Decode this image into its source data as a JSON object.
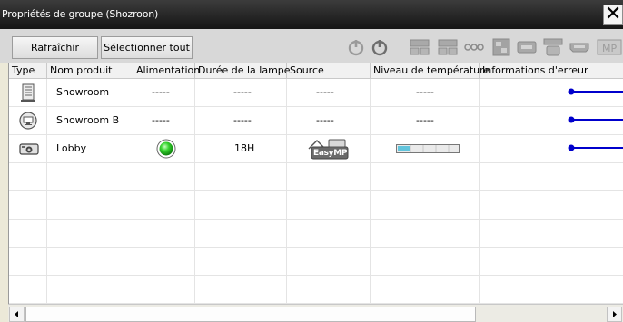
{
  "window": {
    "title": "Propriétés de groupe (Shozroon)",
    "close_glyph": "✕"
  },
  "toolbar": {
    "refresh_label": "Rafraîchir",
    "select_all_label": "Sélectionner tout",
    "icons": [
      "power-on-icon",
      "power-off-icon",
      "source-computer-1-icon",
      "source-computer-2-icon",
      "source-video-icon",
      "source-svideo-icon",
      "source-component-icon",
      "source-dvi-icon",
      "source-hdmi-icon",
      "source-easymp-icon"
    ],
    "icon_labels": {
      "mp": "MP"
    }
  },
  "table": {
    "columns": [
      "Type",
      "Nom produit",
      "Alimentation",
      "Durée de la lampe",
      "Source",
      "Niveau de température",
      "Informations d'erreur"
    ],
    "rows": [
      {
        "type_icon": "server-tower-icon",
        "name": "Showroom",
        "power": "-----",
        "lamp": "-----",
        "source": "-----",
        "temperature": "-----"
      },
      {
        "type_icon": "monitor-icon",
        "name": "Showroom B",
        "power": "-----",
        "lamp": "-----",
        "source": "-----",
        "temperature": "-----"
      },
      {
        "type_icon": "projector-icon",
        "name": "Lobby",
        "power_icon": "green-status-led-icon",
        "lamp": "18H",
        "source_icon": "easymp-source-icon",
        "source_label": "EasyMP",
        "temperature_level": 0.2
      }
    ]
  },
  "colors": {
    "titlebar": "#1d1d1d",
    "error_line": "#0000cc",
    "power_on": "#22bb22",
    "temp_fill": "#62c4dc"
  }
}
